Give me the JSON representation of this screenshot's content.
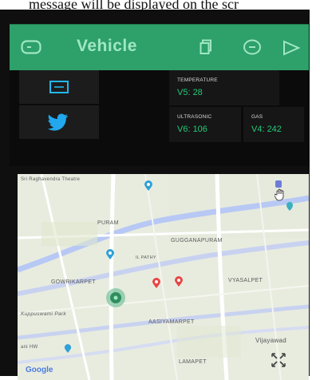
{
  "caption": {
    "text": "message will be displayed on the scr"
  },
  "appbar": {
    "title": "Vehicle",
    "icons": [
      "device-icon",
      "copy-icon",
      "add-icon",
      "play-icon"
    ]
  },
  "widgets": {
    "buttons": [
      {
        "icon": "email-icon"
      },
      {
        "icon": "twitter-icon"
      }
    ],
    "temperature": {
      "label": "TEMPERATURE",
      "value": "V5: 28"
    },
    "ultrasonic": {
      "label": "ULTRASONIC",
      "value": "V6: 106"
    },
    "gas": {
      "label": "GAS",
      "value": "V4: 242"
    }
  },
  "map": {
    "labels": {
      "top_left": "Sri Raghavendra Theatre",
      "puram": "PURAM",
      "gugganapuram": "GUGGANAPURAM",
      "ilpathy": "IL PATHY",
      "gowrikarpet": "GOWRIKARPET",
      "vyasalpet": "VYASALPET",
      "kuppuswami_park": "Kuppuswami Park",
      "aasiyamarpet": "AASIYAMARPET",
      "vijayawada": "Vijayawad",
      "lamapet": "LAMAPET",
      "road_left": "ani HW"
    },
    "logo": "Google",
    "colors": {
      "main_road": "#c8d2f0",
      "river": "#b8c8f5",
      "pin": "#e64545",
      "marker": "#2f8d5f"
    }
  }
}
